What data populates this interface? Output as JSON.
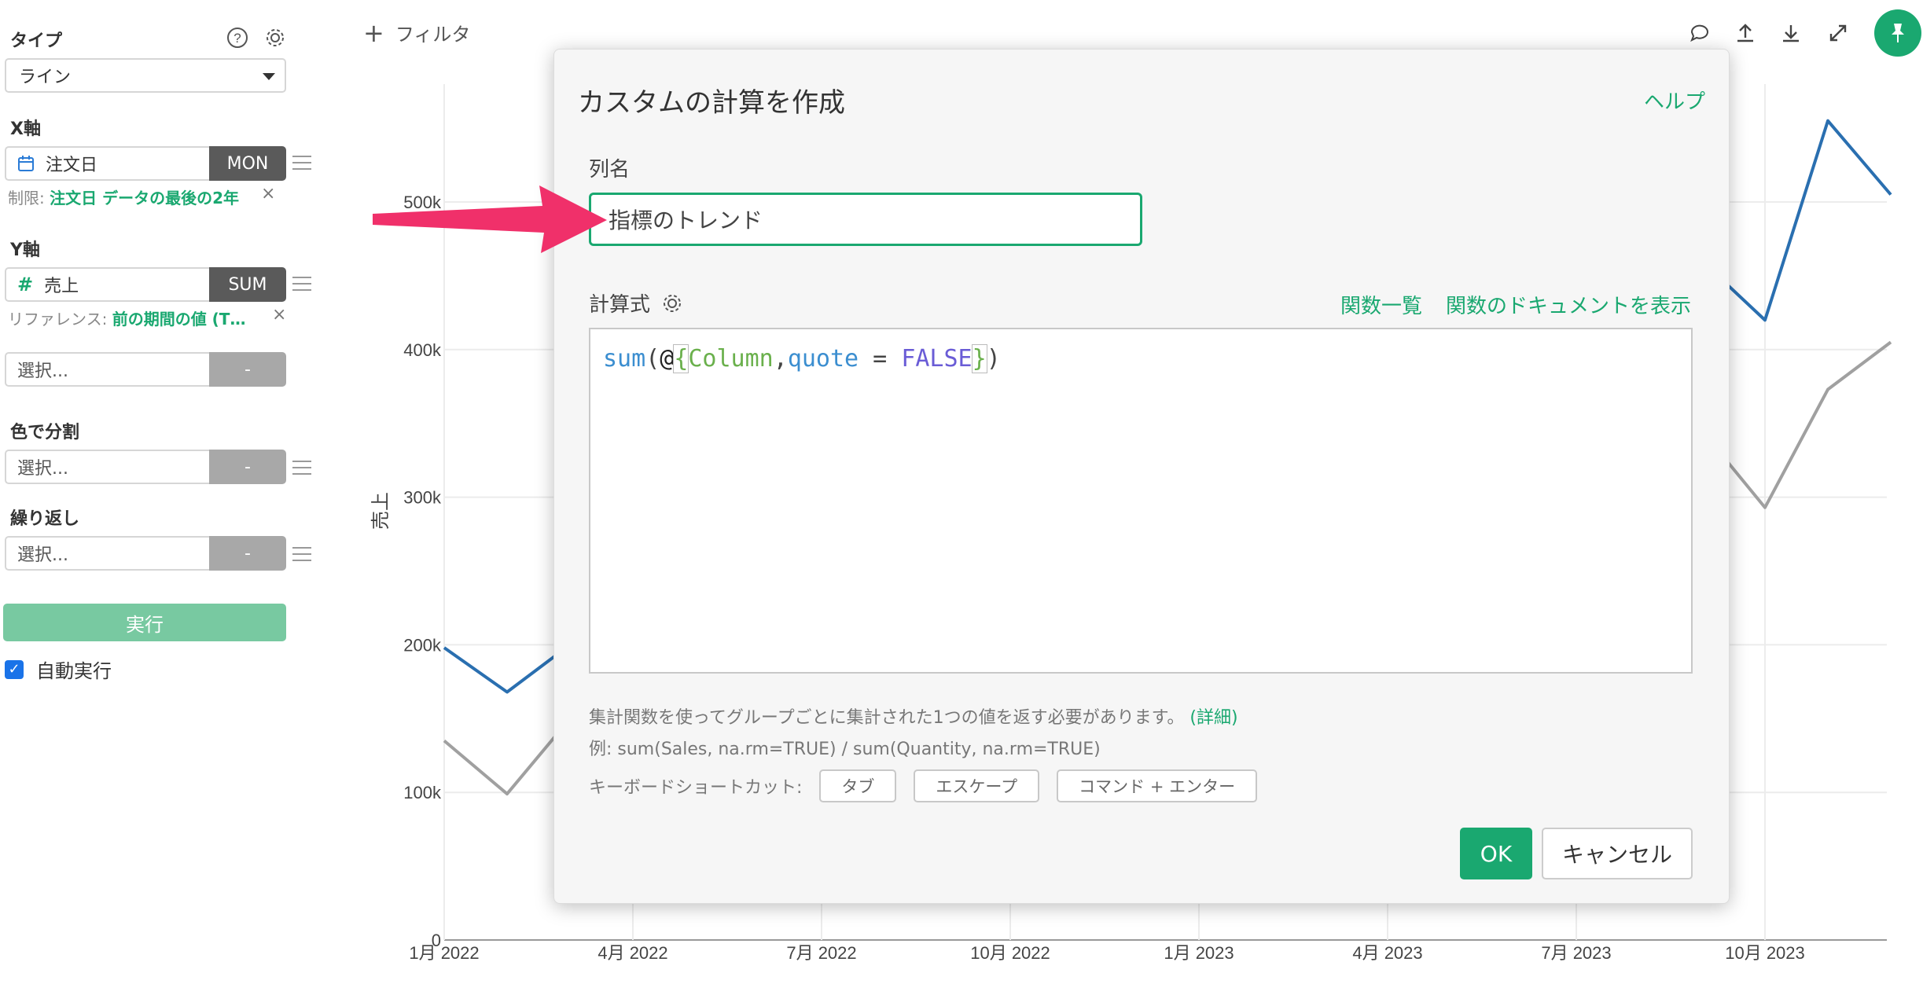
{
  "sidebar": {
    "type_label": "タイプ",
    "type_value": "ライン",
    "x_label": "X軸",
    "x_field": "注文日",
    "x_agg": "MON",
    "x_limit_prefix": "制限: ",
    "x_limit_value": "注文日 データの最後の2年",
    "y_label": "Y軸",
    "y_field": "売上",
    "y_agg": "SUM",
    "y_ref_prefix": "リファレンス: ",
    "y_ref_value": "前の期間の値 (T…",
    "y2_placeholder": "選択...",
    "y2_agg": "-",
    "color_label": "色で分割",
    "color_placeholder": "選択...",
    "color_agg": "-",
    "repeat_label": "繰り返し",
    "repeat_placeholder": "選択...",
    "repeat_agg": "-",
    "run_label": "実行",
    "autorun_label": "自動実行",
    "x_mark": "×"
  },
  "filter": {
    "plus": "+",
    "label": "フィルタ"
  },
  "chart": {
    "ylabel": "売上",
    "y_ticks": [
      "0",
      "100k",
      "200k",
      "300k",
      "400k",
      "500k"
    ],
    "x_ticks": [
      "1月 2022",
      "4月 2022",
      "7月 2022",
      "10月 2022",
      "1月 2023",
      "4月 2023",
      "7月 2023",
      "10月 2023"
    ]
  },
  "chart_data": {
    "type": "line",
    "x": [
      "2022-01",
      "2022-02",
      "2022-03",
      "2022-04",
      "2022-05",
      "2022-06",
      "2022-07",
      "2022-08",
      "2022-09",
      "2022-10",
      "2022-11",
      "2022-12",
      "2023-01",
      "2023-02",
      "2023-03",
      "2023-04",
      "2023-05",
      "2023-06",
      "2023-07",
      "2023-08",
      "2023-09",
      "2023-10",
      "2023-11",
      "2023-12"
    ],
    "series": [
      {
        "color": "#2a6fb0",
        "visible_values": {
          "2022-01": 198000,
          "2022-02": 168000,
          "2022-03": 200000,
          "2023-09": 460000,
          "2023-10": 420000,
          "2023-11": 555000,
          "2023-12": 505000
        }
      },
      {
        "color": "#a0a0a0",
        "visible_values": {
          "2022-01": 135000,
          "2022-02": 99000,
          "2022-03": 150000,
          "2023-09": 345000,
          "2023-10": 293000,
          "2023-11": 373000,
          "2023-12": 405000
        }
      }
    ],
    "ylim": [
      0,
      500000
    ]
  },
  "dialog": {
    "title": "カスタムの計算を作成",
    "help": "ヘルプ",
    "name_label": "列名",
    "name_value": "指標のトレンド",
    "formula_label": "計算式",
    "func_list": "関数一覧",
    "func_docs": "関数のドキュメントを表示",
    "code": {
      "fn": "sum",
      "open": "(",
      "at": "@",
      "lbrace": "{",
      "col": "Column",
      "comma": ",",
      "kw": "quote",
      "eq": " = ",
      "bool": "FALSE",
      "rbrace": "}",
      "close": ")"
    },
    "hint1": "集計関数を使ってグループごとに集計された1つの値を返す必要があります。",
    "hint1_link": "(詳細)",
    "hint2": "例: sum(Sales, na.rm=TRUE) / sum(Quantity, na.rm=TRUE)",
    "shortcut_label": "キーボードショートカット:",
    "shortcuts": [
      "タブ",
      "エスケープ",
      "コマンド + エンター"
    ],
    "ok": "OK",
    "cancel": "キャンセル"
  },
  "colors": {
    "accent": "#1aa870",
    "arrow": "#f0306a",
    "line_blue": "#2a6fb0",
    "line_gray": "#a0a0a0"
  }
}
